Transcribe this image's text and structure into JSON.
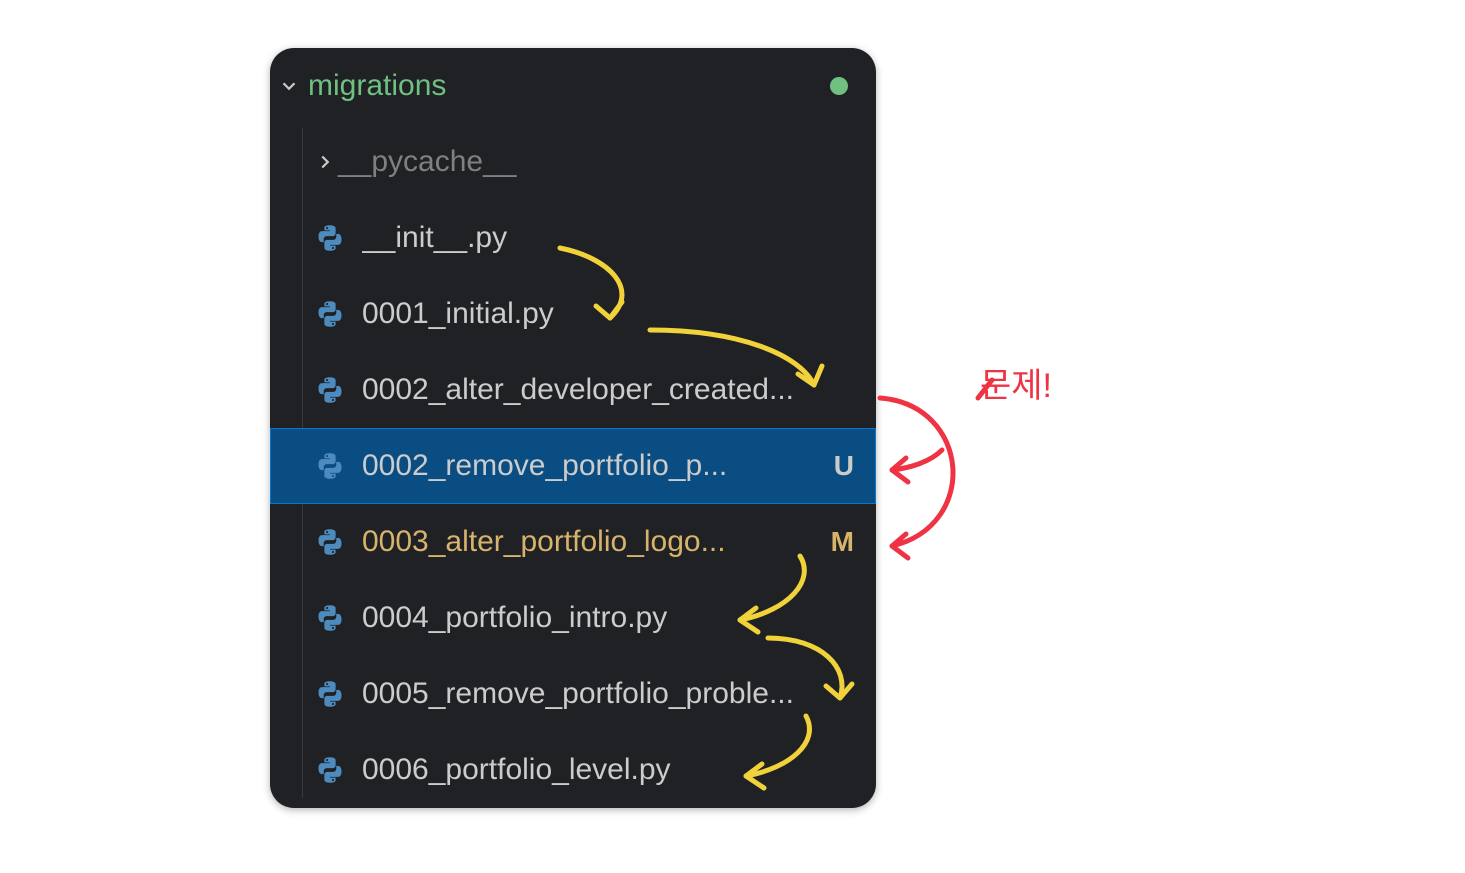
{
  "folder": {
    "name": "migrations",
    "expanded": true
  },
  "subfolder": {
    "name": "__pycache__",
    "expanded": false
  },
  "files": [
    {
      "name": "__init__.py",
      "status": "",
      "selected": false,
      "truncated": false
    },
    {
      "name": "0001_initial.py",
      "status": "",
      "selected": false,
      "truncated": false
    },
    {
      "name": "0002_alter_developer_created...",
      "status": "",
      "selected": false,
      "truncated": true
    },
    {
      "name": "0002_remove_portfolio_p...",
      "status": "U",
      "selected": true,
      "truncated": true
    },
    {
      "name": "0003_alter_portfolio_logo...",
      "status": "M",
      "selected": false,
      "truncated": true
    },
    {
      "name": "0004_portfolio_intro.py",
      "status": "",
      "selected": false,
      "truncated": false
    },
    {
      "name": "0005_remove_portfolio_proble...",
      "status": "",
      "selected": false,
      "truncated": true
    },
    {
      "name": "0006_portfolio_level.py",
      "status": "",
      "selected": false,
      "truncated": false
    }
  ],
  "annotation": {
    "label": "문제!"
  }
}
